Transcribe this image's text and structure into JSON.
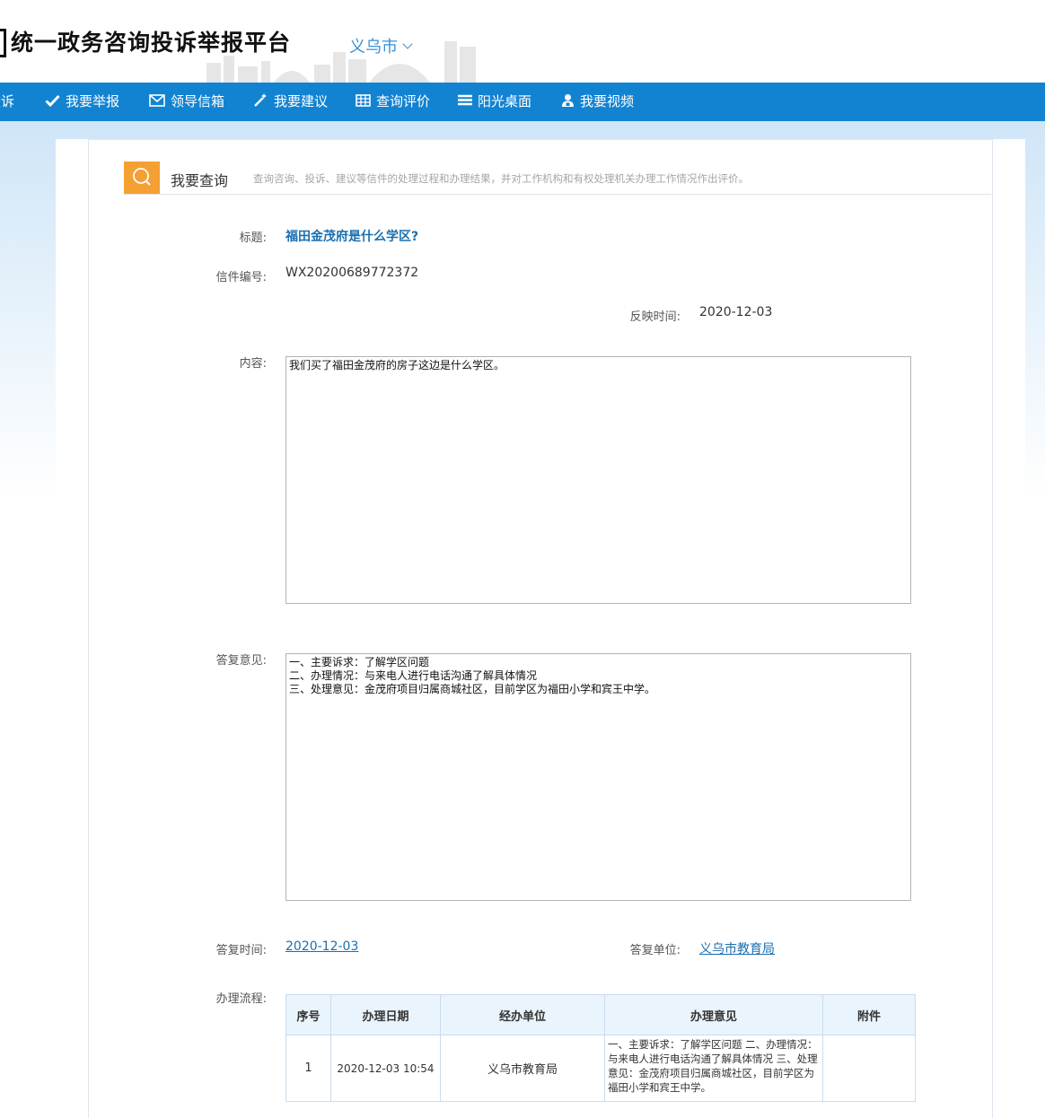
{
  "header": {
    "site_title": "统一政务咨询投诉举报平台",
    "city": "义乌市"
  },
  "nav": {
    "items": [
      {
        "label": "投诉",
        "icon": "edit-icon"
      },
      {
        "label": "我要举报",
        "icon": "check-icon"
      },
      {
        "label": "领导信箱",
        "icon": "mail-icon"
      },
      {
        "label": "我要建议",
        "icon": "wand-icon"
      },
      {
        "label": "查询评价",
        "icon": "table-icon"
      },
      {
        "label": "阳光桌面",
        "icon": "list-icon"
      },
      {
        "label": "我要视频",
        "icon": "user-lock-icon"
      }
    ]
  },
  "section": {
    "title": "我要查询",
    "description": "查询咨询、投诉、建议等信件的处理过程和办理结果，并对工作机构和有权处理机关办理工作情况作出评价。"
  },
  "letter": {
    "title_label": "标题:",
    "title": "福田金茂府是什么学区?",
    "number_label": "信件编号:",
    "number": "WX20200689772372",
    "time_label": "反映时间:",
    "time": "2020-12-03",
    "content_label": "内容:",
    "content": "我们买了福田金茂府的房子这边是什么学区。",
    "reply_label": "答复意见:",
    "reply": "一、主要诉求：了解学区问题\n二、办理情况：与来电人进行电话沟通了解具体情况\n三、处理意见：金茂府项目归属商城社区，目前学区为福田小学和宾王中学。",
    "reply_time_label": "答复时间:",
    "reply_time": "2020-12-03",
    "reply_unit_label": "答复单位:",
    "reply_unit": "义乌市教育局",
    "process_label": "办理流程:"
  },
  "process_table": {
    "headers": [
      "序号",
      "办理日期",
      "经办单位",
      "办理意见",
      "附件"
    ],
    "rows": [
      {
        "no": "1",
        "date": "2020-12-03 10:54",
        "unit": "义乌市教育局",
        "opinion": "一、主要诉求：了解学区问题 二、办理情况：与来电人进行电话沟通了解具体情况 三、处理意见：金茂府项目归属商城社区，目前学区为福田小学和宾王中学。",
        "attachment": ""
      }
    ]
  },
  "colors": {
    "nav_bg": "#1283d1",
    "accent_orange": "#f5a033",
    "link_blue": "#1a6fb0",
    "table_header_bg": "#eaf4fc"
  }
}
